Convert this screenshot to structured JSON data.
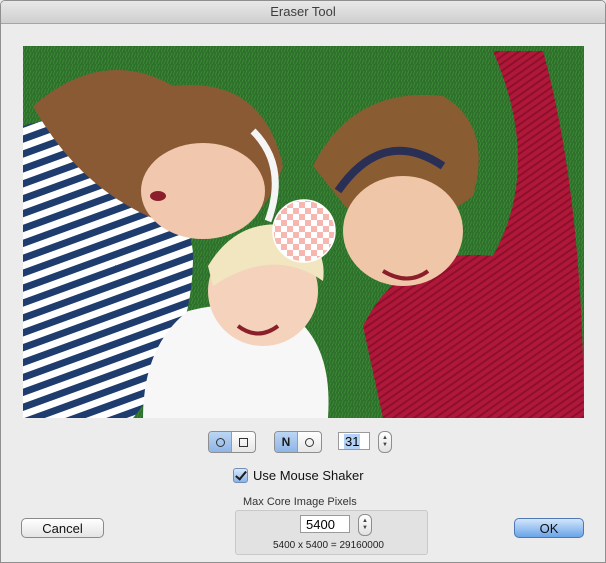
{
  "window": {
    "title": "Eraser Tool"
  },
  "image": {
    "description_icon": "photo-three-children-on-grass-icon",
    "eraser_cursor_icon": "transparent-checkerboard-circle-icon"
  },
  "controls": {
    "shape_options": [
      "circle-icon",
      "square-icon"
    ],
    "shape_selected": "circle",
    "mode_label": "N",
    "mode_options": [
      "N",
      "circle-icon"
    ],
    "brush_size": "31",
    "use_mouse_shaker_label": "Use Mouse Shaker",
    "use_mouse_shaker_checked": true,
    "max_pixels_label": "Max Core Image Pixels",
    "max_pixels_value": "5400",
    "max_pixels_product": "5400 x 5400 = 29160000"
  },
  "buttons": {
    "cancel": "Cancel",
    "ok": "OK"
  },
  "colors": {
    "accent": "#6aa4e8",
    "grass": "#2e7a2a"
  }
}
